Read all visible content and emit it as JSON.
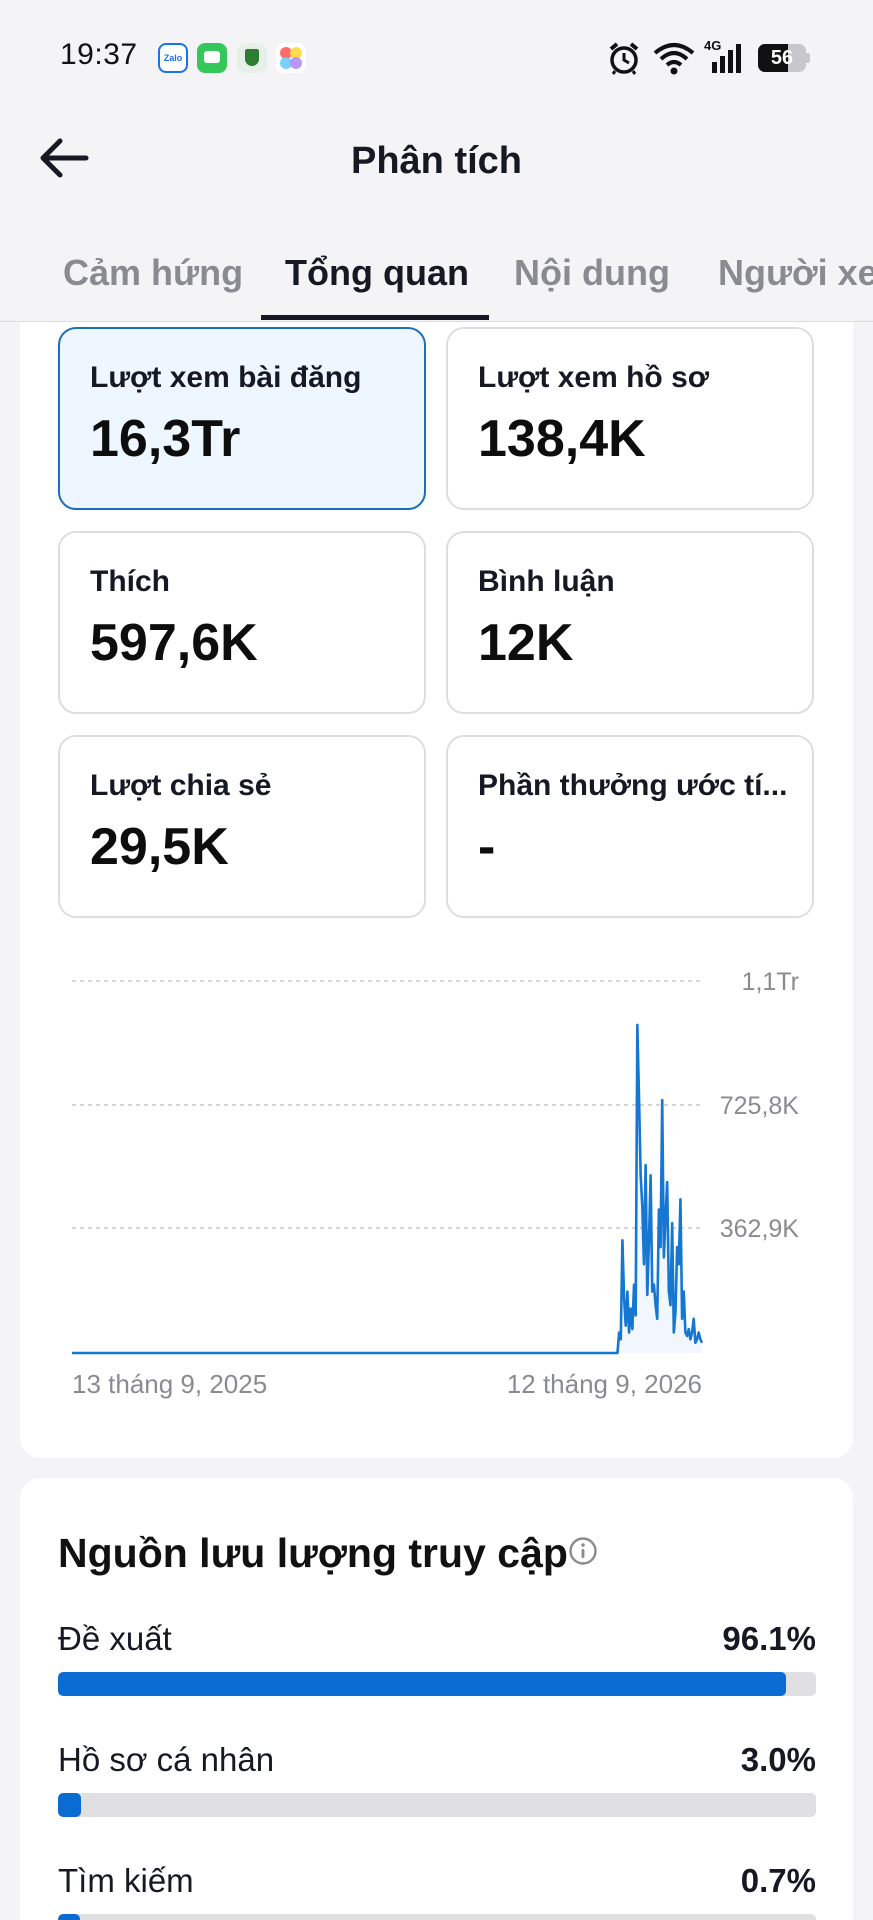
{
  "status_bar": {
    "time": "19:37",
    "notification_icons": [
      "zalo-icon",
      "messages-icon",
      "shield-icon",
      "photos-icon"
    ],
    "zalo_text": "Zalo",
    "network": "4G",
    "battery": "56"
  },
  "app_bar": {
    "title": "Phân tích"
  },
  "tabs": [
    {
      "label": "Cảm hứng",
      "active": false
    },
    {
      "label": "Tổng quan",
      "active": true
    },
    {
      "label": "Nội dung",
      "active": false
    },
    {
      "label": "Người xem",
      "active": false
    }
  ],
  "stats": [
    {
      "label": "Lượt xem bài đăng",
      "value": "16,3Tr",
      "selected": true
    },
    {
      "label": "Lượt xem hồ sơ",
      "value": "138,4K",
      "selected": false
    },
    {
      "label": "Thích",
      "value": "597,6K",
      "selected": false
    },
    {
      "label": "Bình luận",
      "value": "12K",
      "selected": false
    },
    {
      "label": "Lượt chia sẻ",
      "value": "29,5K",
      "selected": false
    },
    {
      "label": "Phần thưởng ước tí...",
      "value": "-",
      "selected": false
    }
  ],
  "chart_data": {
    "type": "line",
    "title": "",
    "xlabel": "",
    "ylabel": "",
    "x_tick_labels": [
      "13 tháng 9, 2025",
      "12 tháng 9, 2026"
    ],
    "y_tick_labels": [
      "1,1Tr",
      "725,8K",
      "362,9K"
    ],
    "ylim": [
      0,
      1088700
    ],
    "grid": true,
    "color": "#1577d1",
    "series": [
      {
        "values": [
          0,
          0,
          0,
          0,
          0,
          0,
          0,
          0,
          0,
          0,
          0,
          0,
          0,
          0,
          0,
          0,
          0,
          0,
          0,
          0,
          0,
          0,
          0,
          0,
          0,
          0,
          0,
          0,
          0,
          0,
          0,
          0,
          0,
          0,
          0,
          0,
          0,
          0,
          0,
          0,
          0,
          0,
          0,
          0,
          0,
          0,
          0,
          0,
          0,
          0,
          0,
          0,
          0,
          0,
          0,
          0,
          0,
          0,
          0,
          0,
          0,
          0,
          0,
          0,
          0,
          0,
          0,
          0,
          0,
          0,
          0,
          0,
          0,
          0,
          0,
          0,
          0,
          0,
          0,
          0,
          0,
          0,
          0,
          0,
          0,
          0,
          0,
          0,
          0,
          0,
          0,
          0,
          0,
          0,
          0,
          0,
          0,
          0,
          0,
          0,
          0,
          0,
          0,
          0,
          0,
          0,
          0,
          0,
          0,
          0,
          0,
          0,
          0,
          0,
          0,
          0,
          0,
          0,
          0,
          0,
          0,
          0,
          0,
          0,
          0,
          0,
          0,
          0,
          0,
          0,
          0,
          0,
          0,
          0,
          0,
          0,
          0,
          0,
          0,
          0,
          0,
          0,
          0,
          0,
          0,
          0,
          0,
          0,
          0,
          0,
          0,
          0,
          0,
          0,
          0,
          0,
          0,
          0,
          0,
          0,
          0,
          0,
          0,
          0,
          0,
          0,
          0,
          0,
          0,
          0,
          0,
          0,
          0,
          0,
          0,
          0,
          0,
          0,
          0,
          0,
          0,
          0,
          0,
          0,
          0,
          0,
          0,
          0,
          0,
          0,
          0,
          0,
          0,
          0,
          0,
          0,
          0,
          0,
          0,
          0,
          0,
          0,
          0,
          0,
          0,
          0,
          0,
          0,
          0,
          0,
          0,
          0,
          0,
          0,
          0,
          0,
          0,
          0,
          0,
          0,
          0,
          0,
          0,
          0,
          0,
          0,
          0,
          0,
          0,
          0,
          0,
          0,
          0,
          0,
          0,
          0,
          0,
          0,
          0,
          0,
          0,
          0,
          0,
          0,
          0,
          0,
          0,
          0,
          0,
          0,
          0,
          0,
          0,
          0,
          0,
          0,
          0,
          0,
          0,
          0,
          0,
          0,
          0,
          0,
          0,
          0,
          0,
          0,
          0,
          0,
          0,
          0,
          0,
          0,
          0,
          0,
          0,
          0,
          0,
          0,
          0,
          0,
          0,
          0,
          0,
          0,
          0,
          0,
          0,
          0,
          0,
          0,
          0,
          0,
          0,
          0,
          0,
          0,
          0,
          0,
          0,
          0,
          0,
          0,
          0,
          0,
          0,
          0,
          0,
          0,
          0,
          0,
          0,
          0,
          0,
          0,
          0,
          0,
          0,
          0,
          0,
          0,
          0,
          0,
          0,
          0,
          0,
          0,
          0,
          0,
          60000,
          40000,
          330000,
          160000,
          80000,
          180000,
          60000,
          130000,
          70000,
          200000,
          110000,
          960000,
          750000,
          520000,
          430000,
          260000,
          550000,
          170000,
          330000,
          520000,
          180000,
          200000,
          140000,
          100000,
          420000,
          310000,
          740000,
          280000,
          400000,
          500000,
          180000,
          140000,
          380000,
          60000,
          120000,
          310000,
          260000,
          450000,
          100000,
          180000,
          60000,
          50000,
          70000,
          40000,
          60000,
          100000,
          30000,
          40000,
          60000,
          40000,
          30000
        ]
      }
    ]
  },
  "traffic": {
    "title": "Nguồn lưu lượng truy cập",
    "sources": [
      {
        "label": "Đề xuất",
        "percent_text": "96.1%",
        "fraction": 0.961
      },
      {
        "label": "Hồ sơ cá nhân",
        "percent_text": "3.0%",
        "fraction": 0.03
      },
      {
        "label": "Tìm kiếm",
        "percent_text": "0.7%",
        "fraction": 0.007
      }
    ]
  }
}
